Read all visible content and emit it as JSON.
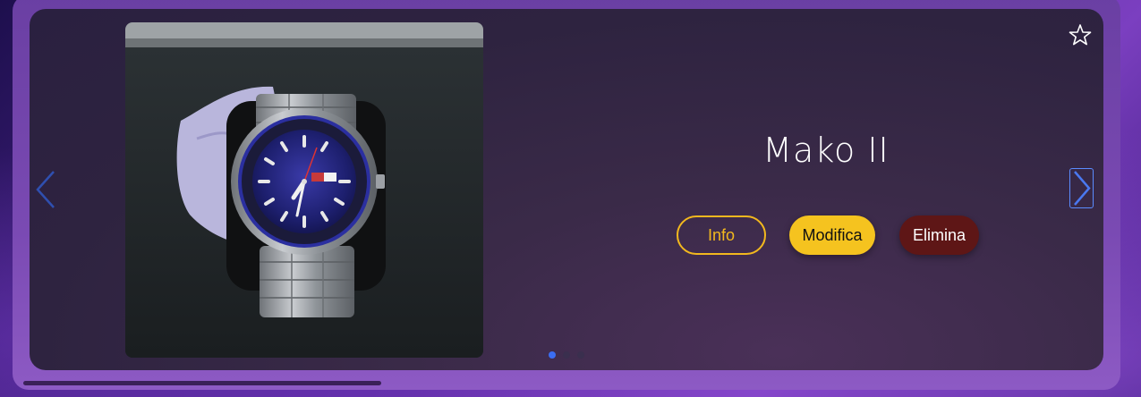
{
  "card": {
    "title": "Mako II",
    "photo_alt": "watch-photo",
    "buttons": {
      "info_label": "Info",
      "edit_label": "Modifica",
      "delete_label": "Elimina"
    },
    "icons": {
      "favorite": "star-outline-icon",
      "prev": "chevron-left-icon",
      "next": "chevron-right-icon"
    }
  },
  "carousel": {
    "slide_count": 3,
    "active_index": 0
  },
  "colors": {
    "accent_yellow": "#f5c31f",
    "delete_red": "#5e1616",
    "dot_active": "#3b6df2",
    "arrow_blue": "#5b8cff"
  }
}
